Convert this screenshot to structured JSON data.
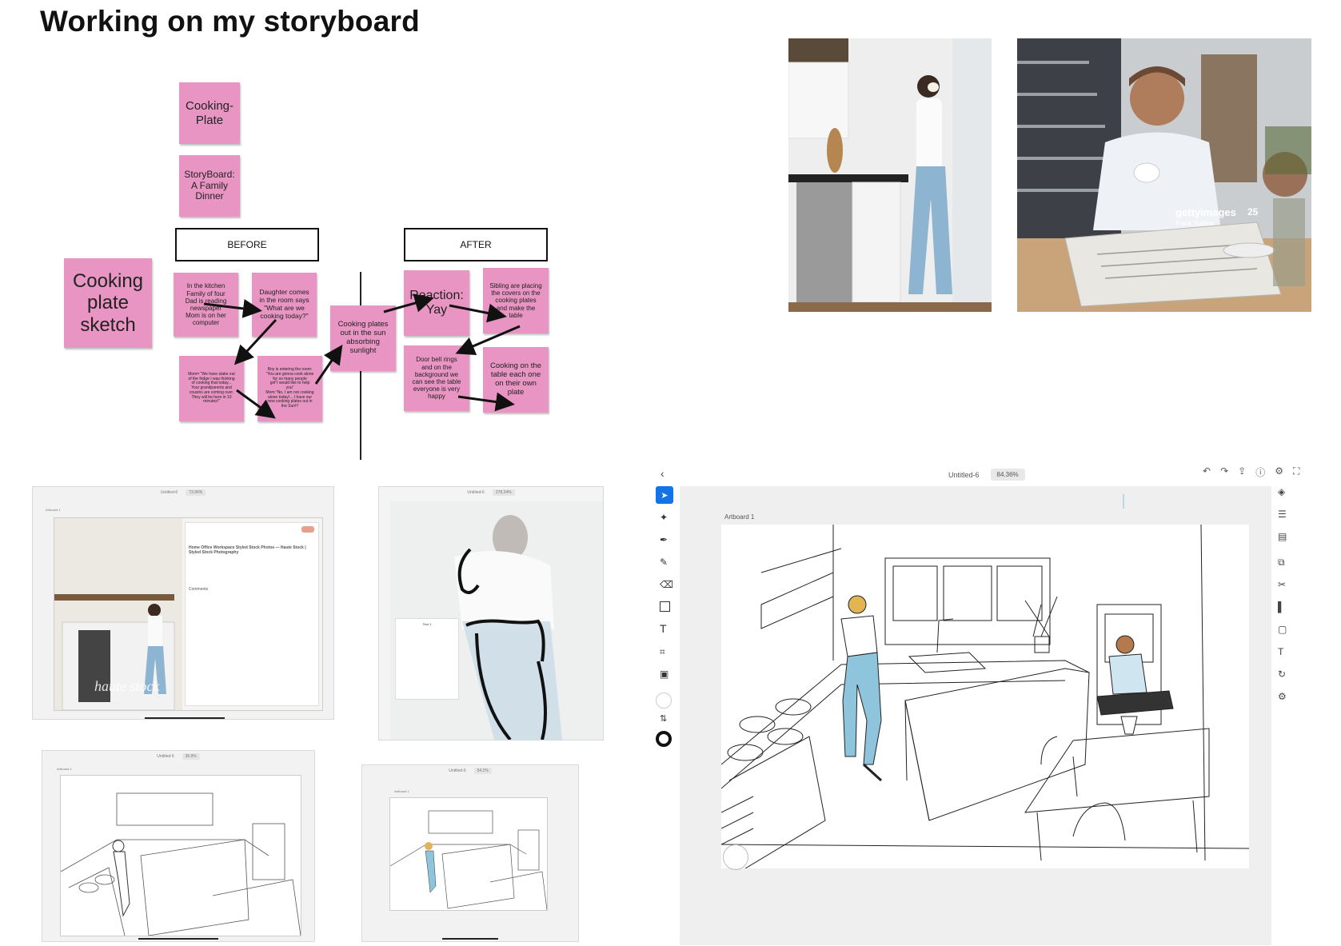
{
  "page_title": "Working on my storyboard",
  "stickies": {
    "cooking_plate": "Cooking-\nPlate",
    "storyboard": "StoryBoard:\nA Family\nDinner",
    "big_note": "Cooking\nplate\nsketch",
    "b1": "In the kitchen\nFamily of four\nDad is reading\nnewspaper\nMom is on her\ncomputer",
    "b2": "Daughter comes\nin the room says\n\"What are we\ncooking today?\"",
    "b3": "Mom= \"We have stake out\nof the fridge I was thinking\nof cooking that today...\nYour grandparents and\ncousins are coming over.\nThey will be here in 10\nminutes!\"",
    "b4": "Boy is entering the room:\n\"You are gonna cook alone\nfor so many people\ngirl\"I would like to help\nyou\"\nMom:\"No, I am not cooking\nalone today!... I have our\nnew cooking plates out in\nthe Sun!!!",
    "mid": "Cooking plates\nout in the sun\nabsorbing\nsunlight",
    "a1": "Reaction:\nYay",
    "a2": "Sibling are placing\nthe covers on the\ncooking plates\nand make the\ntable",
    "a3": "Door bell rings\nand on the\nbackground we\ncan see the table\neveryone is very\nhappy",
    "a4": "Cooking on the\ntable each one\non their own\nplate"
  },
  "headers": {
    "before": "BEFORE",
    "after": "AFTER"
  },
  "photos": {
    "watermark_brand": "gettyimages",
    "watermark_credit": "Frank Sulbert",
    "watermark_years": "25"
  },
  "mini_apps": {
    "shot1_title": "Untitled-6",
    "shot1_zoom": "73.96%",
    "shot1_artboard": "Artboard 1",
    "shot1_panel_title": "Home Office Workspace Styled Stock Photos — Haute Stock | Styled Stock Photography",
    "shot1_comments": "Comments",
    "shot1_watermark": "haute stock",
    "shot2_title": "Untitled-6",
    "shot2_zoom": "278.34%",
    "shot2_popup": "Text 1",
    "shot3_title": "Untitled-6",
    "shot3_zoom": "36.9%",
    "shot3_artboard": "Artboard 1",
    "shot4_title": "Untitled-6",
    "shot4_zoom": "54.1%",
    "shot4_artboard": "Artboard 1"
  },
  "main_app": {
    "doc_title": "Untitled-6",
    "zoom": "84.36%",
    "artboard_label": "Artboard 1",
    "accent": "#1473e6"
  },
  "colors": {
    "sticky": "#e995c3",
    "jeans": "#8ec5dc"
  }
}
